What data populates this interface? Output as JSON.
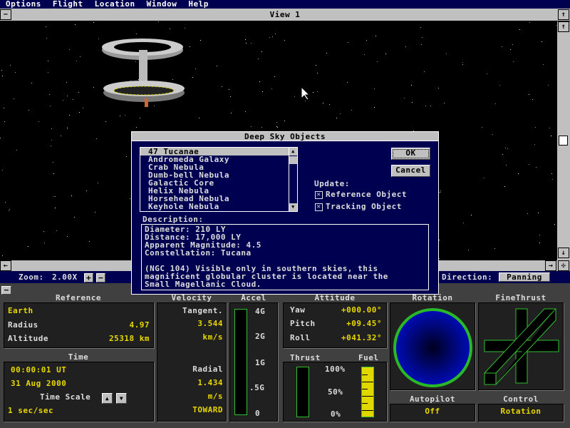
{
  "menu": [
    "Options",
    "Flight",
    "Location",
    "Window",
    "Help"
  ],
  "view": {
    "title": "View 1"
  },
  "zoom": {
    "label": "Zoom:",
    "value": "2.00X",
    "plus": "+",
    "minus": "−"
  },
  "direction": {
    "label": "Direction:",
    "value": "Panning"
  },
  "panel": {
    "collapse": "−"
  },
  "reference": {
    "header": "Reference",
    "body": "Earth",
    "radius_label": "Radius",
    "radius": "4.97",
    "altitude_label": "Altitude",
    "altitude": "25318 km"
  },
  "time": {
    "header": "Time",
    "clock": "00:00:01 UT",
    "date": "31 Aug 2000",
    "scale_label": "Time Scale",
    "scale": "1 sec/sec"
  },
  "velocity": {
    "header": "Velocity",
    "tangent_label": "Tangent.",
    "tangent": "3.544",
    "tangent_unit": "km/s",
    "radial_label": "Radial",
    "radial": "1.434",
    "radial_unit": "m/s",
    "radial_dir": "TOWARD"
  },
  "accel": {
    "header": "Accel",
    "ticks": [
      "4G",
      "2G",
      "1G",
      ".5G",
      "0"
    ]
  },
  "attitude": {
    "header": "Attitude",
    "yaw_label": "Yaw",
    "yaw": "+000.00°",
    "pitch_label": "Pitch",
    "pitch": "+09.45°",
    "roll_label": "Roll",
    "roll": "+041.32°"
  },
  "thrust": {
    "header": "Thrust",
    "fuel_header": "Fuel",
    "ticks": [
      "100%",
      "50%",
      "0%"
    ],
    "thrust_level": 0,
    "fuel_level": 1.0
  },
  "rotation": {
    "header": "Rotation"
  },
  "finethrust": {
    "header": "FineThrust"
  },
  "autopilot": {
    "header": "Autopilot",
    "value": "Off"
  },
  "control": {
    "header": "Control",
    "value": "Rotation"
  },
  "dialog": {
    "title": "Deep Sky Objects",
    "items": [
      "47 Tucanae",
      "Andromeda Galaxy",
      "Crab Nebula",
      "Dumb-bell Nebula",
      "Galactic Core",
      "Helix Nebula",
      "Horsehead Nebula",
      "Keyhole Nebula"
    ],
    "ok": "OK",
    "cancel": "Cancel",
    "update_label": "Update:",
    "ref_obj": "Reference Object",
    "track_obj": "Tracking Object",
    "desc_label": "Description:",
    "desc": "Diameter: 210 LY\nDistance: 17,000 LY\nApparent Magnitude: 4.5\nConstellation: Tucana\n\n(NGC 104) Visible only in southern skies, this\nmagnificent globular cluster is located near the\nSmall Magellanic Cloud."
  },
  "colors": {
    "navy": "#000050",
    "yellow": "#e8d800",
    "green": "#30c030",
    "blue": "#0010f0"
  }
}
